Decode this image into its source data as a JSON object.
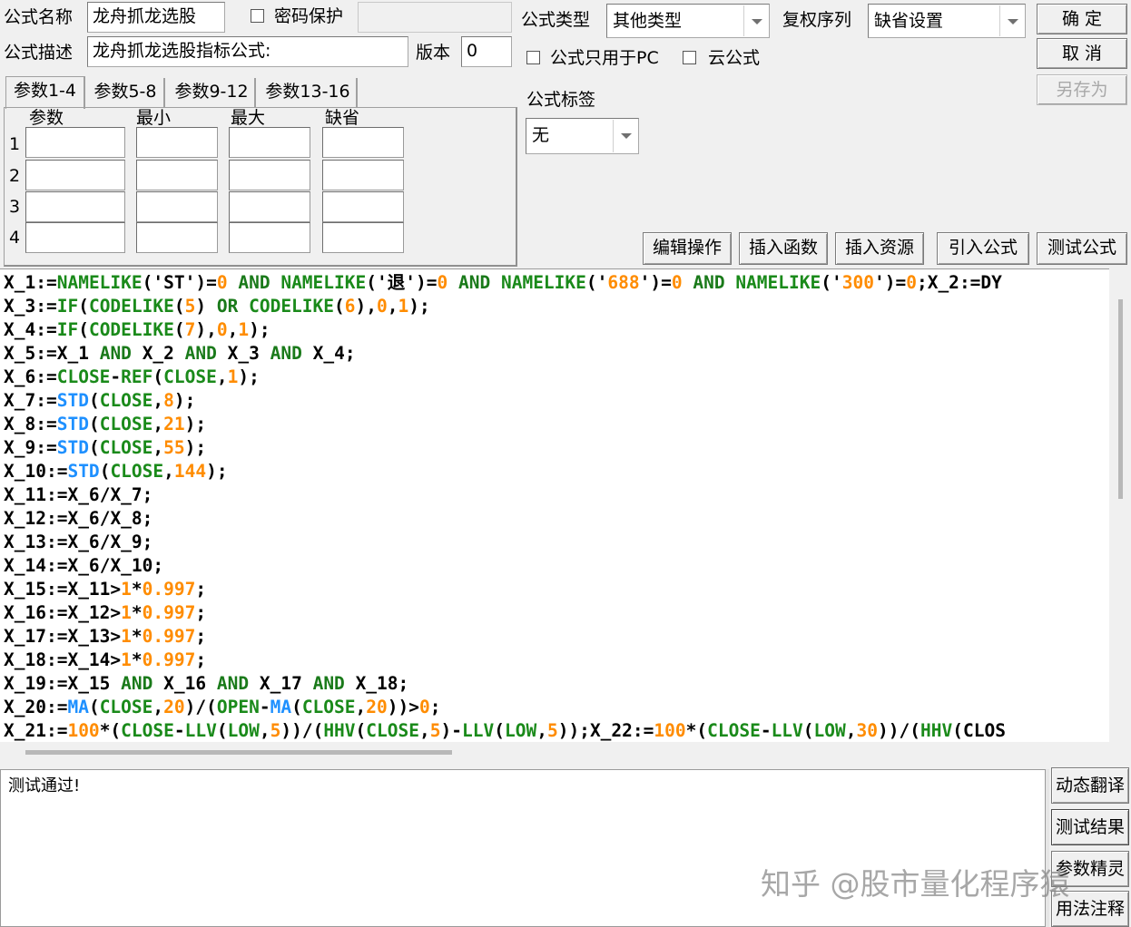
{
  "header": {
    "formula_name_label": "公式名称",
    "formula_name_value": "龙舟抓龙选股",
    "password_label": "密码保护",
    "password_value": "",
    "formula_desc_label": "公式描述",
    "formula_desc_value": "龙舟抓龙选股指标公式:",
    "version_label": "版本",
    "version_value": "0",
    "type_label": "公式类型",
    "type_value": "其他类型",
    "rights_label": "复权序列",
    "rights_value": "缺省设置",
    "pc_only_label": "公式只用于PC",
    "cloud_label": "云公式",
    "tag_label": "公式标签",
    "tag_value": "无"
  },
  "actions": {
    "ok": "确 定",
    "cancel": "取 消",
    "save_as": "另存为"
  },
  "tabs": [
    "参数1-4",
    "参数5-8",
    "参数9-12",
    "参数13-16"
  ],
  "param_headers": [
    "参数",
    "最小",
    "最大",
    "缺省"
  ],
  "param_rows": [
    "1",
    "2",
    "3",
    "4"
  ],
  "toolbar": {
    "edit": "编辑操作",
    "insert_func": "插入函数",
    "insert_res": "插入资源",
    "import": "引入公式",
    "test": "测试公式"
  },
  "code_lines": [
    "X_1:=NAMELIKE('ST')=0 AND NAMELIKE('退')=0 AND NAMELIKE('688')=0 AND NAMELIKE('300')=0;X_2:=DY",
    "X_3:=IF(CODELIKE(5) OR CODELIKE(6),0,1);",
    "X_4:=IF(CODELIKE(7),0,1);",
    "X_5:=X_1 AND X_2 AND X_3 AND X_4;",
    "X_6:=CLOSE-REF(CLOSE,1);",
    "X_7:=STD(CLOSE,8);",
    "X_8:=STD(CLOSE,21);",
    "X_9:=STD(CLOSE,55);",
    "X_10:=STD(CLOSE,144);",
    "X_11:=X_6/X_7;",
    "X_12:=X_6/X_8;",
    "X_13:=X_6/X_9;",
    "X_14:=X_6/X_10;",
    "X_15:=X_11>1*0.997;",
    "X_16:=X_12>1*0.997;",
    "X_17:=X_13>1*0.997;",
    "X_18:=X_14>1*0.997;",
    "X_19:=X_15 AND X_16 AND X_17 AND X_18;",
    "X_20:=MA(CLOSE,20)/(OPEN-MA(CLOSE,20))>0;",
    "X_21:=100*(CLOSE-LLV(LOW,5))/(HHV(CLOSE,5)-LLV(LOW,5));X_22:=100*(CLOSE-LLV(LOW,30))/(HHV(CLOS"
  ],
  "output_text": "测试通过!",
  "side_buttons": [
    "动态翻译",
    "测试结果",
    "参数精灵",
    "用法注释"
  ],
  "watermark": "知乎 @股市量化程序猿"
}
